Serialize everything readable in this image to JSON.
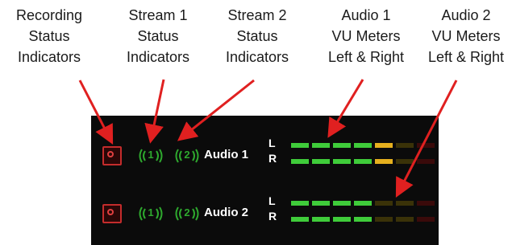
{
  "callouts": {
    "recording": [
      "Recording",
      "Status",
      "Indicators"
    ],
    "stream1": [
      "Stream 1",
      "Status",
      "Indicators"
    ],
    "stream2": [
      "Stream 2",
      "Status",
      "Indicators"
    ],
    "audio1": [
      "Audio 1",
      "VU Meters",
      "Left & Right"
    ],
    "audio2": [
      "Audio 2",
      "VU Meters",
      "Left & Right"
    ]
  },
  "rows": [
    {
      "audio_label": "Audio 1",
      "stream1_number": "1",
      "stream2_number": "2",
      "left_label": "L",
      "right_label": "R",
      "left_level": [
        "green",
        "green",
        "green",
        "green",
        "yellow",
        "dim-yellow",
        "dim-red"
      ],
      "right_level": [
        "green",
        "green",
        "green",
        "green",
        "yellow",
        "dim-yellow",
        "dim-red"
      ]
    },
    {
      "audio_label": "Audio 2",
      "stream1_number": "1",
      "stream2_number": "2",
      "left_label": "L",
      "right_label": "R",
      "left_level": [
        "green",
        "green",
        "green",
        "green",
        "dim-yellow",
        "dim-yellow",
        "dim-red"
      ],
      "right_level": [
        "green",
        "green",
        "green",
        "green",
        "dim-yellow",
        "dim-yellow",
        "dim-red"
      ]
    }
  ],
  "colors": {
    "green": "#3fcc3a",
    "yellow": "#e6b01e",
    "dim-yellow": "#3a3208",
    "dim-red": "#3a0a0a",
    "arrow": "#e02020",
    "record": "#c42c2c",
    "stream": "#2ea82e"
  },
  "icons": {
    "record": "record-icon",
    "stream": "broadcast-wave-icon"
  }
}
